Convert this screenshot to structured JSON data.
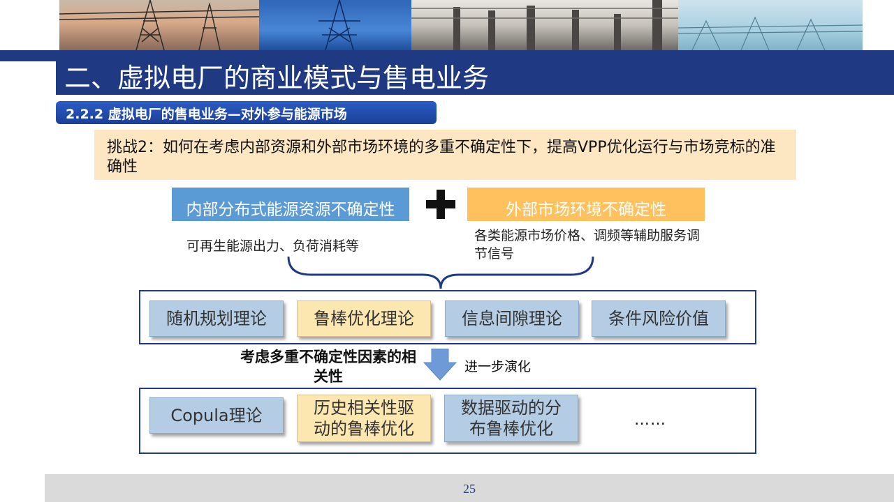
{
  "title": "二、虚拟电厂的商业模式与售电业务",
  "subtitle": "2.2.2  虚拟电厂的售电业务—对外参与能源市场",
  "challenge": "挑战2：如何在考虑内部资源和外部市场环境的多重不确定性下，提高VPP优化运行与市场竞标的准确性",
  "internal": {
    "label": "内部分布式能源资源不确定性",
    "note": "可再生能源出力、负荷消耗等"
  },
  "external": {
    "label": "外部市场环境不确定性",
    "note": "各类能源市场价格、调频等辅助服务调节信号"
  },
  "row1": [
    {
      "label": "随机规划理论",
      "color": "blue"
    },
    {
      "label": "鲁棒优化理论",
      "color": "yellow"
    },
    {
      "label": "信息间隙理论",
      "color": "blue"
    },
    {
      "label": "条件风险价值",
      "color": "blue"
    }
  ],
  "evolve": {
    "factor": "考虑多重不确定性因素的相关性",
    "note": "进一步演化"
  },
  "row2": [
    {
      "label": "Copula理论",
      "color": "blue"
    },
    {
      "label": "历史相关性驱动的鲁棒优化",
      "color": "yellow"
    },
    {
      "label": "数据驱动的分布鲁棒优化",
      "color": "blue"
    }
  ],
  "ellipsis": "……",
  "page_number": "25",
  "colors": {
    "navy": "#1f3a83",
    "internal_box": "#5b9bd5",
    "external_box": "#ffc15e",
    "chip_blue": "#b4cde4",
    "chip_yellow": "#fde7b0",
    "challenge_bg": "#fde7c3"
  }
}
